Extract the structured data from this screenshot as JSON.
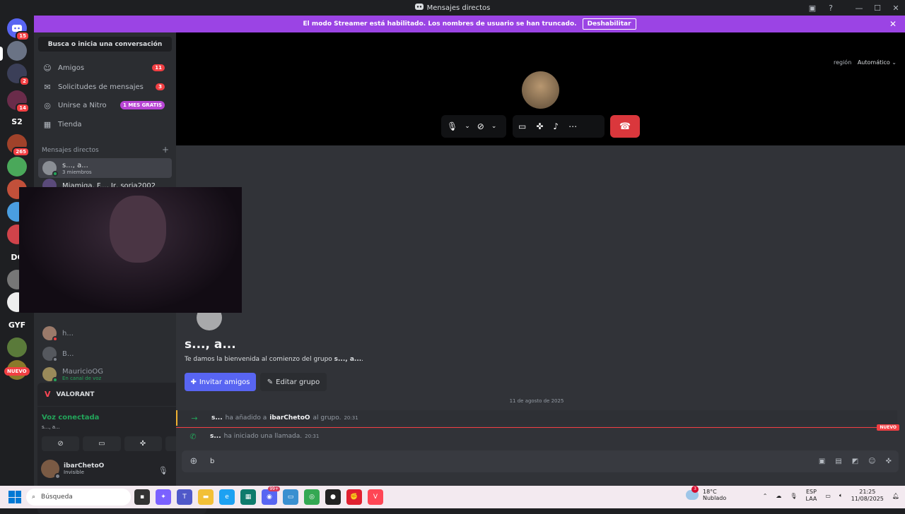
{
  "window": {
    "title": "Mensajes directos"
  },
  "banner": {
    "text": "El modo Streamer está habilitado. Los nombres de usuario se han truncado.",
    "button": "Deshabilitar"
  },
  "guilds": {
    "badges": [
      "15",
      "2",
      "14",
      "265"
    ],
    "text_items": [
      "S2",
      "DC",
      "GYF"
    ],
    "nuevo": "NUEVO"
  },
  "sidebar": {
    "search": "Busca o inicia una conversación",
    "nav": [
      {
        "label": "Amigos",
        "badge": "11"
      },
      {
        "label": "Solicitudes de mensajes",
        "badge": "3"
      },
      {
        "label": "Unirse a Nitro",
        "badge": "1 MES GRATIS"
      },
      {
        "label": "Tienda"
      }
    ],
    "dm_header": "Mensajes directos",
    "dms": [
      {
        "name": "s..., a...",
        "sub": "3 miembros"
      },
      {
        "name": "Miamiga, F..., Ir, soria2002"
      },
      {
        "name": "h..."
      },
      {
        "name": "B..."
      },
      {
        "name": "MauricioOG",
        "sub": "En canal de voz"
      }
    ]
  },
  "voice_panel": {
    "activity": "VALORANT",
    "status": "Voz conectada",
    "channel": "s..., a...",
    "user": {
      "name": "ibarChetoO",
      "status": "Invisible"
    }
  },
  "call": {
    "region_label": "región",
    "region_value": "Automático"
  },
  "chat": {
    "title": "s..., a...",
    "welcome_prefix": "Te damos la bienvenida al comienzo del grupo ",
    "welcome_group": "s..., a...",
    "welcome_suffix": ".",
    "invite": "Invitar amigos",
    "edit": "Editar grupo",
    "date": "11 de agosto de 2025",
    "messages": [
      {
        "actor": "s...",
        "text_before": "ha añadido a",
        "target": "ibarChetoO",
        "text_after": "al grupo.",
        "time": "20:31"
      },
      {
        "actor": "s...",
        "text_before": "ha iniciado una llamada.",
        "time": "20:31"
      }
    ],
    "new_label": "NUEVO",
    "composer_text": "b"
  },
  "taskbar": {
    "search": "Búsqueda",
    "discord_badge": "99+",
    "weather_badge": "3",
    "temp": "18°C",
    "weather": "Nublado",
    "lang1": "ESP",
    "lang2": "LAA",
    "time": "21:25",
    "date": "11/08/2025"
  }
}
